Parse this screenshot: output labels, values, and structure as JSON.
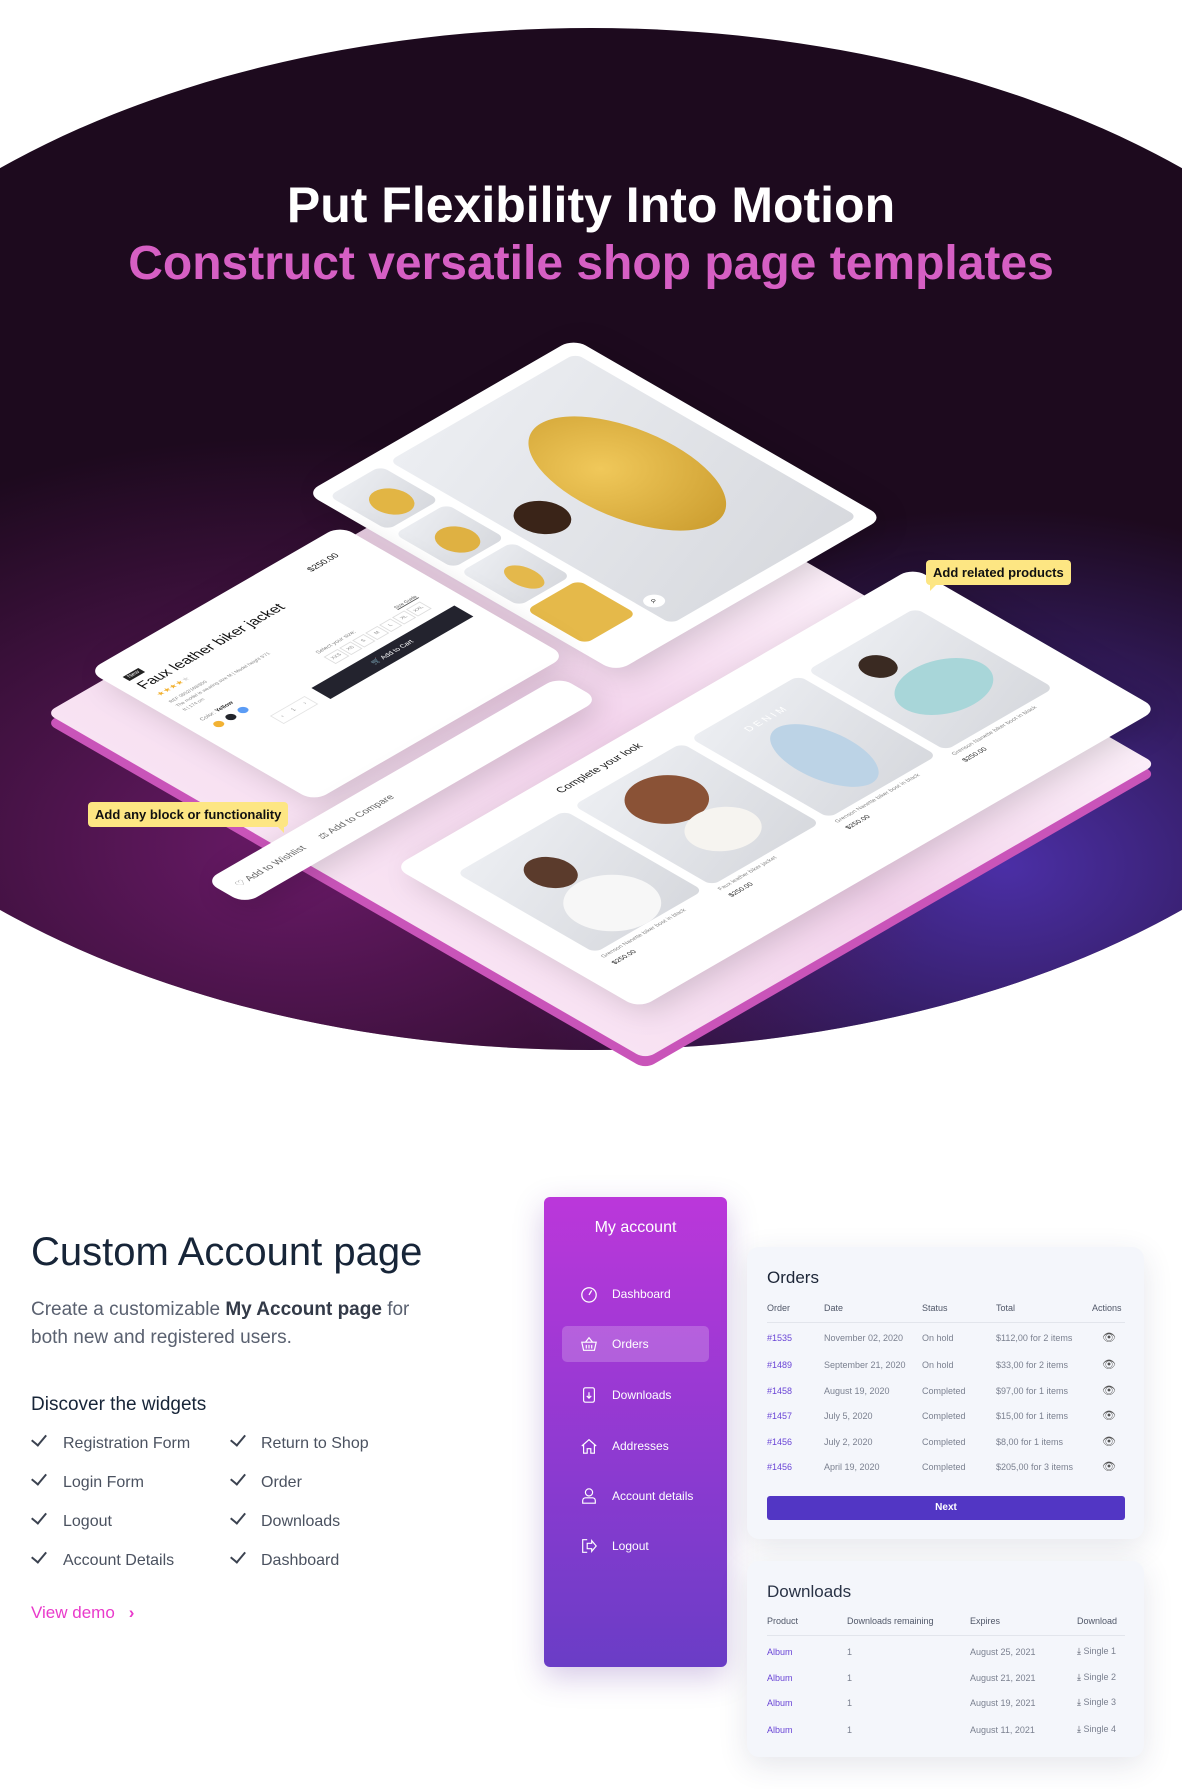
{
  "hero": {
    "title": "Put Flexibility Into Motion",
    "subtitle": "Construct versatile shop page templates",
    "title_color": "#ffffff",
    "subtitle_color": "#d65fc4",
    "callouts": {
      "related": "Add related products",
      "block": "Add any block or functionality"
    },
    "product": {
      "badge": "New",
      "name": "Faux leather biker jacket",
      "price": "$250.00",
      "rating": 4,
      "ref": "REF 0852/168/800",
      "model_info": "The model is wearing size M | Model height 5'71",
      "height": "ft | 174 cm",
      "color_label": "Color:",
      "color_value": "Yellow",
      "swatches": [
        "#f2b233",
        "#22242b",
        "#5b9cf5"
      ],
      "size_label": "Select your size:",
      "size_guide": "Size Guide",
      "sizes": [
        "XXS",
        "XS",
        "S",
        "M",
        "L",
        "XL",
        "XXL"
      ],
      "quantity": "1",
      "add_to_cart": "Add to Cart"
    },
    "actions": {
      "wishlist": "Add to Wishlist",
      "compare": "Add to Compare"
    },
    "related": {
      "title": "Complete your look",
      "items": [
        {
          "name": "Grenson Nanette biker boot in black",
          "price": "$250.00"
        },
        {
          "name": "Faux leather biker jacket",
          "price": "$250.00"
        },
        {
          "name": "Grenson Nanette biker boot in black",
          "price": "$250.00"
        },
        {
          "name": "Grenson Nanette biker boot in black",
          "price": "$250.00"
        }
      ],
      "denim_text": "DENIM"
    }
  },
  "account": {
    "title": "Custom Account page",
    "desc_pre": "Create a customizable ",
    "desc_bold": "My Account page",
    "desc_post": " for both new and registered users.",
    "widgets_title": "Discover the widgets",
    "widgets": [
      "Registration Form",
      "Login Form",
      "Logout",
      "Account Details",
      "Return to Shop",
      "Order",
      "Downloads",
      "Dashboard"
    ],
    "view_demo": "View demo",
    "accent": "#e93acb"
  },
  "sidebar": {
    "title": "My account",
    "items": [
      {
        "label": "Dashboard",
        "icon": "gauge-icon"
      },
      {
        "label": "Orders",
        "icon": "basket-icon",
        "active": true
      },
      {
        "label": "Downloads",
        "icon": "file-download-icon"
      },
      {
        "label": "Addresses",
        "icon": "home-icon"
      },
      {
        "label": "Account details",
        "icon": "user-icon"
      },
      {
        "label": "Logout",
        "icon": "logout-icon"
      }
    ]
  },
  "orders": {
    "title": "Orders",
    "headers": [
      "Order",
      "Date",
      "Status",
      "Total",
      "Actions"
    ],
    "rows": [
      [
        "#1535",
        "November 02, 2020",
        "On hold",
        "$112,00 for 2 items"
      ],
      [
        "#1489",
        "September 21, 2020",
        "On hold",
        "$33,00 for 2 items"
      ],
      [
        "#1458",
        "August 19, 2020",
        "Completed",
        "$97,00 for 1 items"
      ],
      [
        "#1457",
        "July 5, 2020",
        "Completed",
        "$15,00 for 1 items"
      ],
      [
        "#1456",
        "July 2, 2020",
        "Completed",
        "$8,00 for 1 items"
      ],
      [
        "#1456",
        "April 19, 2020",
        "Completed",
        "$205,00 for 3 items"
      ]
    ],
    "next": "Next",
    "button_color": "#5236c4"
  },
  "downloads": {
    "title": "Downloads",
    "headers": [
      "Product",
      "Downloads remaining",
      "Expires",
      "Download"
    ],
    "rows": [
      [
        "Album",
        "1",
        "August 25, 2021",
        "Single 1"
      ],
      [
        "Album",
        "1",
        "August 21, 2021",
        "Single 2"
      ],
      [
        "Album",
        "1",
        "August 19, 2021",
        "Single 3"
      ],
      [
        "Album",
        "1",
        "August 11, 2021",
        "Single 4"
      ]
    ]
  }
}
